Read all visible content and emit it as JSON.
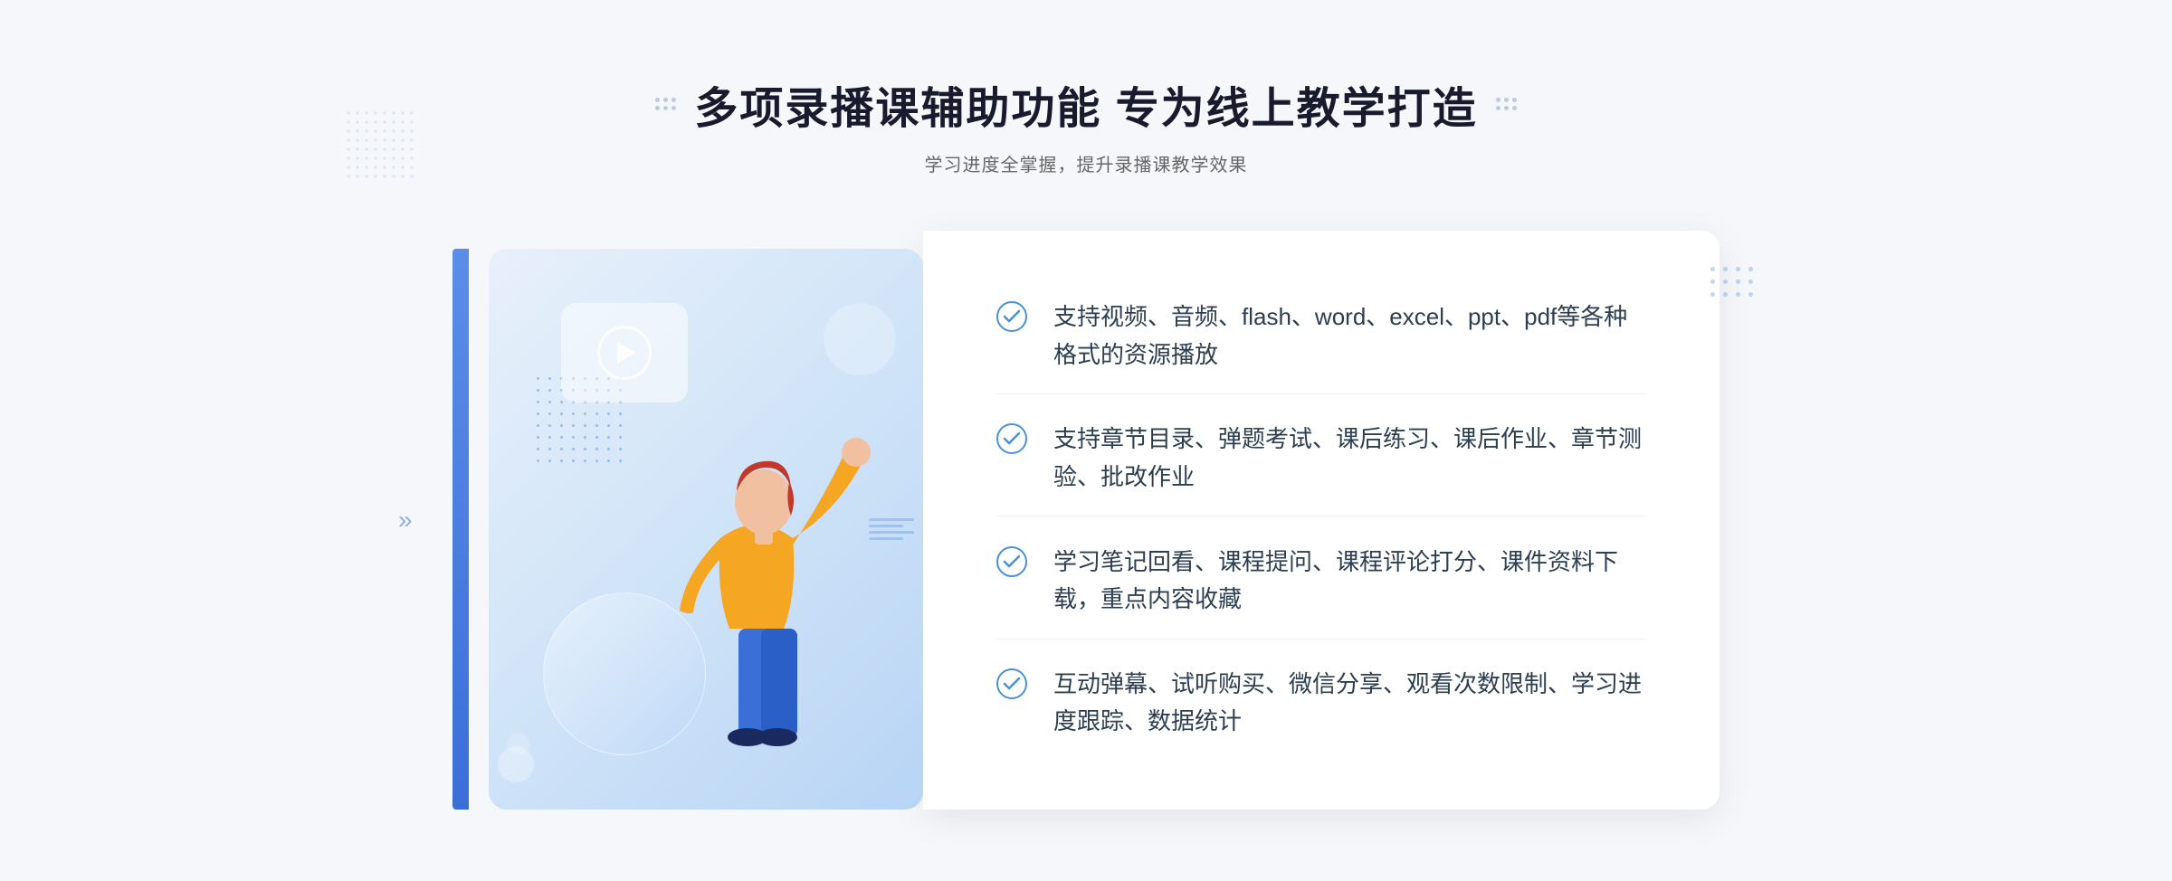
{
  "header": {
    "main_title": "多项录播课辅助功能 专为线上教学打造",
    "sub_title": "学习进度全掌握，提升录播课教学效果"
  },
  "features": [
    {
      "id": "feature-1",
      "text": "支持视频、音频、flash、word、excel、ppt、pdf等各种格式的资源播放"
    },
    {
      "id": "feature-2",
      "text": "支持章节目录、弹题考试、课后练习、课后作业、章节测验、批改作业"
    },
    {
      "id": "feature-3",
      "text": "学习笔记回看、课程提问、课程评论打分、课件资料下载，重点内容收藏"
    },
    {
      "id": "feature-4",
      "text": "互动弹幕、试听购买、微信分享、观看次数限制、学习进度跟踪、数据统计"
    }
  ],
  "decoration": {
    "left_chevrons": "»",
    "play_label": "play"
  }
}
